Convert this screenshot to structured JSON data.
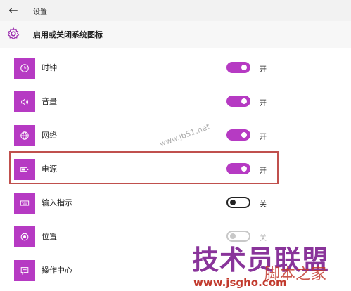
{
  "topbar": {
    "title": "设置"
  },
  "header": {
    "title": "启用或关闭系统图标"
  },
  "items": [
    {
      "label": "时钟",
      "state": "开",
      "icon": "clock-icon"
    },
    {
      "label": "音量",
      "state": "开",
      "icon": "volume-icon"
    },
    {
      "label": "网络",
      "state": "开",
      "icon": "network-globe-icon"
    },
    {
      "label": "电源",
      "state": "开",
      "icon": "battery-icon"
    },
    {
      "label": "输入指示",
      "state": "关",
      "icon": "keyboard-icon"
    },
    {
      "label": "位置",
      "state": "关",
      "icon": "location-icon"
    },
    {
      "label": "操作中心",
      "state": "",
      "icon": "action-center-icon"
    }
  ],
  "colors": {
    "accent": "#b63ac3",
    "highlight": "#c0504d"
  },
  "watermarks": {
    "main": "技术员联盟",
    "url": "www.jsgho.com",
    "side": "脚本之家",
    "jb": "www.jb51.net"
  }
}
